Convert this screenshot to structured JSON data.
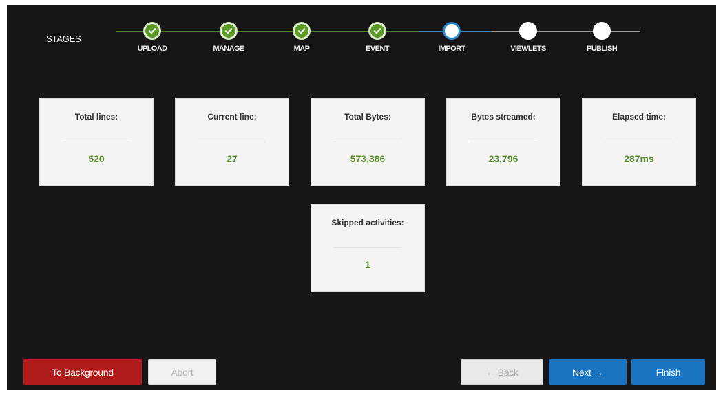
{
  "stages": {
    "label": "STAGES",
    "items": [
      {
        "label": "UPLOAD",
        "status": "done"
      },
      {
        "label": "MANAGE",
        "status": "done"
      },
      {
        "label": "MAP",
        "status": "done"
      },
      {
        "label": "EVENT",
        "status": "done"
      },
      {
        "label": "IMPORT",
        "status": "active"
      },
      {
        "label": "VIEWLETS",
        "status": "todo"
      },
      {
        "label": "PUBLISH",
        "status": "todo"
      }
    ]
  },
  "stats": [
    {
      "title": "Total lines:",
      "value": "520"
    },
    {
      "title": "Current line:",
      "value": "27"
    },
    {
      "title": "Total Bytes:",
      "value": "573,386"
    },
    {
      "title": "Bytes streamed:",
      "value": "23,796"
    },
    {
      "title": "Elapsed time:",
      "value": "287ms"
    },
    {
      "title": "Skipped activities:",
      "value": "1"
    }
  ],
  "buttons": {
    "to_background": "To Background",
    "abort": "Abort",
    "back": "← Back",
    "next": "Next →",
    "finish": "Finish"
  },
  "colors": {
    "background": "#171515",
    "done": "#5b9a27",
    "active": "#2b87c8",
    "danger": "#b01b1b",
    "primary": "#1a74c2",
    "value_text": "#5a8b2a"
  }
}
